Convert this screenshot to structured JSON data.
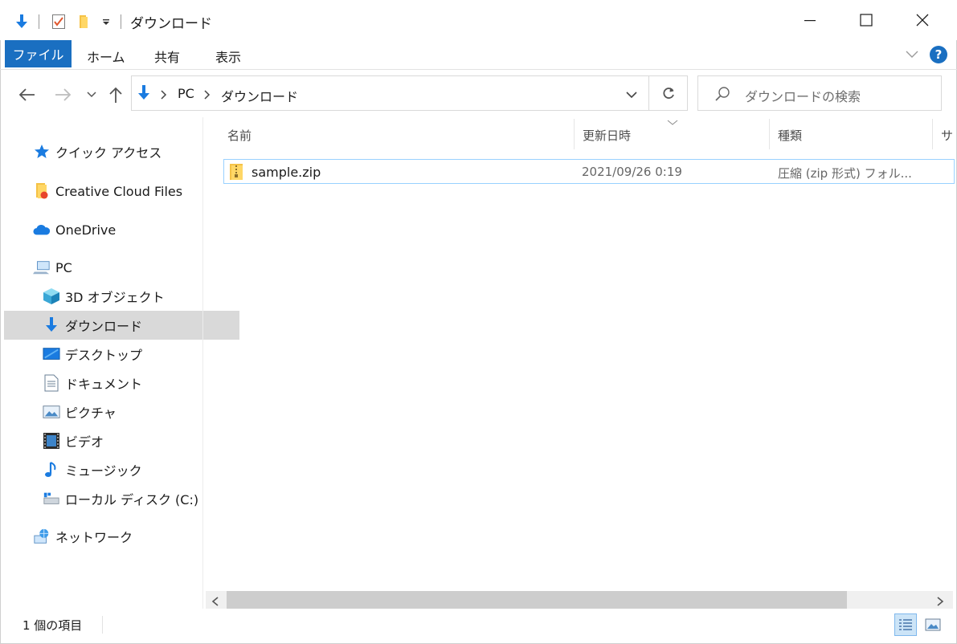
{
  "window": {
    "title": "ダウンロード"
  },
  "ribbon": {
    "tabs": [
      {
        "label": "ファイル"
      },
      {
        "label": "ホーム"
      },
      {
        "label": "共有"
      },
      {
        "label": "表示"
      }
    ],
    "help_label": "?"
  },
  "address": {
    "segments": [
      "PC",
      "ダウンロード"
    ]
  },
  "search": {
    "placeholder": "ダウンロードの検索"
  },
  "sidebar": {
    "items": [
      {
        "label": "クイック アクセス",
        "icon": "star-icon"
      },
      {
        "label": "Creative Cloud Files",
        "icon": "creative-cloud-folder-icon"
      },
      {
        "label": "OneDrive",
        "icon": "cloud-icon"
      },
      {
        "label": "PC",
        "icon": "computer-icon"
      },
      {
        "label": "3D オブジェクト",
        "icon": "cube-icon"
      },
      {
        "label": "ダウンロード",
        "icon": "download-arrow-icon",
        "selected": true
      },
      {
        "label": "デスクトップ",
        "icon": "desktop-icon"
      },
      {
        "label": "ドキュメント",
        "icon": "document-icon"
      },
      {
        "label": "ピクチャ",
        "icon": "picture-icon"
      },
      {
        "label": "ビデオ",
        "icon": "film-icon"
      },
      {
        "label": "ミュージック",
        "icon": "music-note-icon"
      },
      {
        "label": "ローカル ディスク (C:)",
        "icon": "drive-icon"
      },
      {
        "label": "ネットワーク",
        "icon": "network-icon"
      }
    ]
  },
  "file_list": {
    "columns": [
      "名前",
      "更新日時",
      "種類",
      "サ"
    ],
    "rows": [
      {
        "name": "sample.zip",
        "modified": "2021/09/26 0:19",
        "type": "圧縮 (zip 形式) フォル...",
        "icon": "zip-folder-icon"
      }
    ]
  },
  "status": {
    "item_count": "1 個の項目"
  },
  "colors": {
    "accent": "#1a6fc1",
    "selection_bg": "#d9d9d9",
    "row_border": "#99d1ff"
  }
}
